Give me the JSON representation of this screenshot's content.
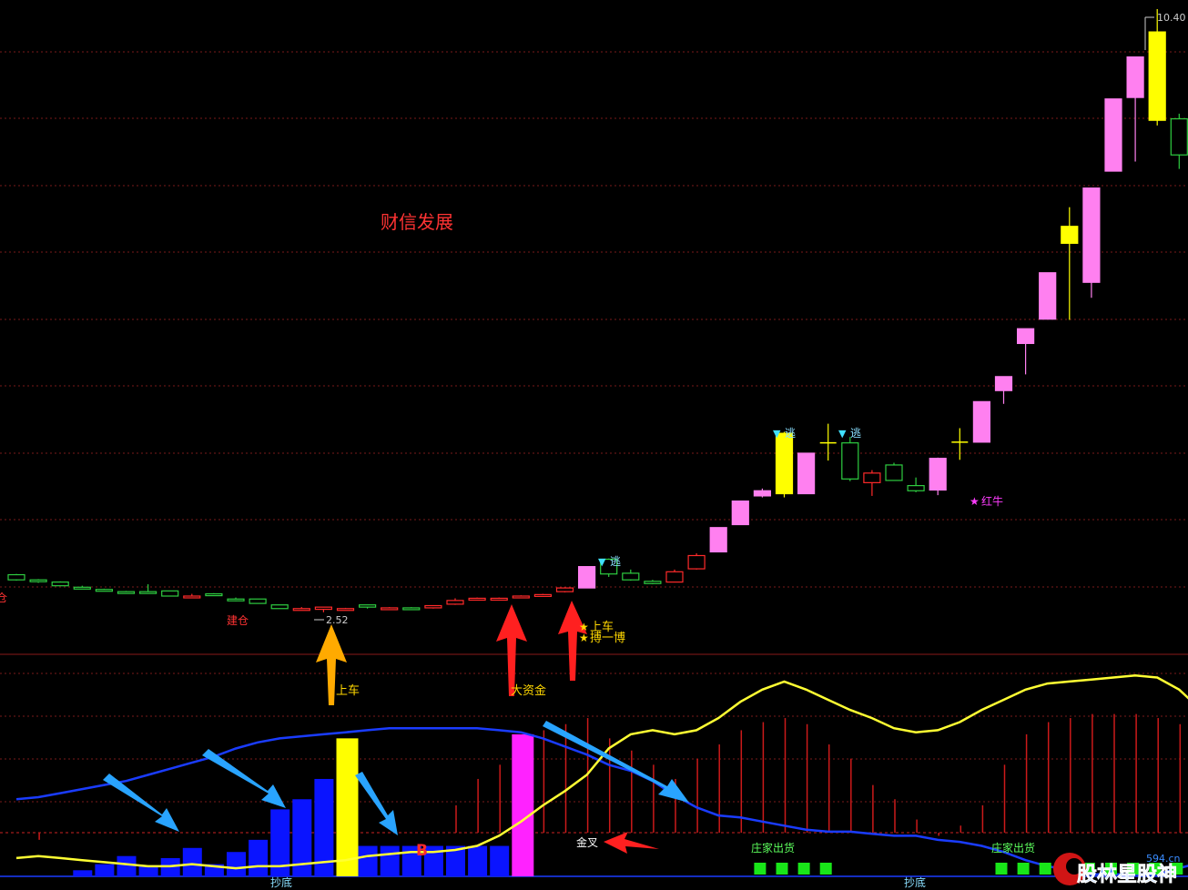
{
  "stock_name": "财信发展",
  "colors": {
    "bg": "#000000",
    "grid": "#7a1a1a",
    "up": "#ff2a2a",
    "down": "#2ecc40",
    "pink": "#ff80f0",
    "yellow": "#ffff00",
    "blue_bar": "#0a14ff",
    "magenta": "#ff22ff",
    "blue_line": "#1a3cff",
    "yellow_line": "#ffff33",
    "cyan": "#40e0ff",
    "vol_red": "#cc1a1a",
    "label_red": "#ff3333",
    "label_gold": "#ffd700",
    "label_white": "#ffffff",
    "label_green": "#5dff5d",
    "label_cyan": "#8adfff",
    "label_magenta": "#ff3dff"
  },
  "chart_data": {
    "type": "candlestick",
    "title": "财信发展",
    "price_high_label": "10.40",
    "price_low_label": "2.52",
    "ylim": [
      1.8,
      10.9
    ],
    "candles": [
      {
        "o": 2.96,
        "c": 3.03,
        "h": 3.04,
        "l": 2.95,
        "t": "down"
      },
      {
        "o": 2.94,
        "c": 2.96,
        "h": 2.97,
        "l": 2.92,
        "t": "down"
      },
      {
        "o": 2.88,
        "c": 2.93,
        "h": 2.94,
        "l": 2.88,
        "t": "down"
      },
      {
        "o": 2.86,
        "c": 2.86,
        "h": 2.88,
        "l": 2.84,
        "t": "down"
      },
      {
        "o": 2.81,
        "c": 2.83,
        "h": 2.84,
        "l": 2.81,
        "t": "down"
      },
      {
        "o": 2.8,
        "c": 2.8,
        "h": 2.81,
        "l": 2.79,
        "t": "down"
      },
      {
        "o": 2.8,
        "c": 2.8,
        "h": 2.9,
        "l": 2.79,
        "t": "down"
      },
      {
        "o": 2.74,
        "c": 2.81,
        "h": 2.81,
        "l": 2.74,
        "t": "down"
      },
      {
        "o": 2.74,
        "c": 2.74,
        "h": 2.77,
        "l": 2.73,
        "t": "up"
      },
      {
        "o": 2.75,
        "c": 2.77,
        "h": 2.78,
        "l": 2.75,
        "t": "down"
      },
      {
        "o": 2.7,
        "c": 2.7,
        "h": 2.72,
        "l": 2.67,
        "t": "down"
      },
      {
        "o": 2.64,
        "c": 2.7,
        "h": 2.7,
        "l": 2.64,
        "t": "down"
      },
      {
        "o": 2.57,
        "c": 2.62,
        "h": 2.62,
        "l": 2.57,
        "t": "down"
      },
      {
        "o": 2.57,
        "c": 2.57,
        "h": 2.59,
        "l": 2.56,
        "t": "up"
      },
      {
        "o": 2.56,
        "c": 2.59,
        "h": 2.59,
        "l": 2.52,
        "t": "up"
      },
      {
        "o": 2.57,
        "c": 2.57,
        "h": 2.58,
        "l": 2.55,
        "t": "up"
      },
      {
        "o": 2.59,
        "c": 2.62,
        "h": 2.62,
        "l": 2.57,
        "t": "down"
      },
      {
        "o": 2.57,
        "c": 2.58,
        "h": 2.59,
        "l": 2.57,
        "t": "up"
      },
      {
        "o": 2.58,
        "c": 2.58,
        "h": 2.59,
        "l": 2.57,
        "t": "down"
      },
      {
        "o": 2.58,
        "c": 2.61,
        "h": 2.61,
        "l": 2.57,
        "t": "up"
      },
      {
        "o": 2.63,
        "c": 2.68,
        "h": 2.71,
        "l": 2.62,
        "t": "up"
      },
      {
        "o": 2.7,
        "c": 2.71,
        "h": 2.72,
        "l": 2.69,
        "t": "up"
      },
      {
        "o": 2.71,
        "c": 2.71,
        "h": 2.72,
        "l": 2.7,
        "t": "up"
      },
      {
        "o": 2.73,
        "c": 2.74,
        "h": 2.75,
        "l": 2.71,
        "t": "up"
      },
      {
        "o": 2.76,
        "c": 2.75,
        "h": 2.77,
        "l": 2.74,
        "t": "up"
      },
      {
        "o": 2.8,
        "c": 2.85,
        "h": 2.86,
        "l": 2.79,
        "t": "up"
      },
      {
        "o": 2.85,
        "c": 3.14,
        "h": 3.14,
        "l": 2.85,
        "t": "pink"
      },
      {
        "o": 3.24,
        "c": 3.04,
        "h": 3.25,
        "l": 3.0,
        "t": "down"
      },
      {
        "o": 3.05,
        "c": 2.96,
        "h": 3.1,
        "l": 2.95,
        "t": "down"
      },
      {
        "o": 2.94,
        "c": 2.91,
        "h": 2.96,
        "l": 2.9,
        "t": "down"
      },
      {
        "o": 2.93,
        "c": 3.07,
        "h": 3.1,
        "l": 2.93,
        "t": "up"
      },
      {
        "o": 3.11,
        "c": 3.29,
        "h": 3.32,
        "l": 3.1,
        "t": "up"
      },
      {
        "o": 3.34,
        "c": 3.67,
        "h": 3.67,
        "l": 3.34,
        "t": "pink"
      },
      {
        "o": 3.71,
        "c": 4.03,
        "h": 4.03,
        "l": 3.71,
        "t": "pink"
      },
      {
        "o": 4.1,
        "c": 4.17,
        "h": 4.2,
        "l": 4.08,
        "t": "pink"
      },
      {
        "o": 4.13,
        "c": 4.95,
        "h": 4.97,
        "l": 4.08,
        "t": "yellow"
      },
      {
        "o": 4.13,
        "c": 4.68,
        "h": 4.68,
        "l": 4.13,
        "t": "pink"
      },
      {
        "o": 4.82,
        "c": 4.82,
        "h": 5.08,
        "l": 4.58,
        "t": "flat"
      },
      {
        "o": 4.82,
        "c": 4.33,
        "h": 4.9,
        "l": 4.3,
        "t": "down"
      },
      {
        "o": 4.28,
        "c": 4.41,
        "h": 4.45,
        "l": 4.1,
        "t": "up"
      },
      {
        "o": 4.31,
        "c": 4.52,
        "h": 4.55,
        "l": 4.31,
        "t": "down"
      },
      {
        "o": 4.17,
        "c": 4.24,
        "h": 4.35,
        "l": 4.15,
        "t": "down"
      },
      {
        "o": 4.18,
        "c": 4.61,
        "h": 4.62,
        "l": 4.11,
        "t": "pink"
      },
      {
        "o": 4.83,
        "c": 4.83,
        "h": 5.02,
        "l": 4.59,
        "t": "flat"
      },
      {
        "o": 4.83,
        "c": 5.38,
        "h": 5.38,
        "l": 4.83,
        "t": "pink"
      },
      {
        "o": 5.53,
        "c": 5.72,
        "h": 5.72,
        "l": 5.35,
        "t": "pink"
      },
      {
        "o": 6.17,
        "c": 6.37,
        "h": 6.37,
        "l": 5.75,
        "t": "pink"
      },
      {
        "o": 6.5,
        "c": 7.13,
        "h": 7.13,
        "l": 6.5,
        "t": "pink"
      },
      {
        "o": 7.53,
        "c": 7.76,
        "h": 8.02,
        "l": 6.49,
        "t": "yellow"
      },
      {
        "o": 7.0,
        "c": 8.28,
        "h": 8.28,
        "l": 6.79,
        "t": "pink"
      },
      {
        "o": 8.51,
        "c": 9.49,
        "h": 9.49,
        "l": 8.51,
        "t": "pink"
      },
      {
        "o": 9.51,
        "c": 10.06,
        "h": 10.06,
        "l": 8.64,
        "t": "pink"
      },
      {
        "o": 9.2,
        "c": 10.4,
        "h": 10.71,
        "l": 9.13,
        "t": "yellow"
      },
      {
        "o": 9.22,
        "c": 8.73,
        "h": 9.29,
        "l": 8.54,
        "t": "down"
      },
      {
        "o": 8.52,
        "c": 8.37,
        "h": 8.72,
        "l": 8.36,
        "t": "down"
      }
    ],
    "indicator": {
      "ylim": [
        0,
        100
      ],
      "bars": [
        {
          "i": 3,
          "v": 3,
          "c": "blue"
        },
        {
          "i": 4,
          "v": 6,
          "c": "blue"
        },
        {
          "i": 5,
          "v": 10,
          "c": "blue"
        },
        {
          "i": 6,
          "v": 5,
          "c": "blue"
        },
        {
          "i": 7,
          "v": 9,
          "c": "blue"
        },
        {
          "i": 8,
          "v": 14,
          "c": "blue"
        },
        {
          "i": 9,
          "v": 6,
          "c": "blue"
        },
        {
          "i": 10,
          "v": 12,
          "c": "blue"
        },
        {
          "i": 11,
          "v": 18,
          "c": "blue"
        },
        {
          "i": 12,
          "v": 33,
          "c": "blue"
        },
        {
          "i": 13,
          "v": 38,
          "c": "blue"
        },
        {
          "i": 14,
          "v": 48,
          "c": "blue"
        },
        {
          "i": 15,
          "v": 68,
          "c": "yellow"
        },
        {
          "i": 16,
          "v": 15,
          "c": "blue"
        },
        {
          "i": 17,
          "v": 15,
          "c": "blue"
        },
        {
          "i": 18,
          "v": 15,
          "c": "blue"
        },
        {
          "i": 19,
          "v": 15,
          "c": "blue"
        },
        {
          "i": 20,
          "v": 15,
          "c": "blue"
        },
        {
          "i": 21,
          "v": 15,
          "c": "blue"
        },
        {
          "i": 22,
          "v": 15,
          "c": "blue"
        },
        {
          "i": 23,
          "v": 70,
          "c": "magenta"
        }
      ],
      "thin_bars": [
        {
          "i": 1,
          "v": 18
        },
        {
          "i": 20,
          "v": 35
        },
        {
          "i": 21,
          "v": 48
        },
        {
          "i": 22,
          "v": 55
        },
        {
          "i": 24,
          "v": 72
        },
        {
          "i": 25,
          "v": 75
        },
        {
          "i": 26,
          "v": 78
        },
        {
          "i": 27,
          "v": 68
        },
        {
          "i": 28,
          "v": 62
        },
        {
          "i": 29,
          "v": 55
        },
        {
          "i": 30,
          "v": 48
        },
        {
          "i": 31,
          "v": 58
        },
        {
          "i": 32,
          "v": 65
        },
        {
          "i": 33,
          "v": 72
        },
        {
          "i": 34,
          "v": 76
        },
        {
          "i": 35,
          "v": 78
        },
        {
          "i": 36,
          "v": 75
        },
        {
          "i": 37,
          "v": 65
        },
        {
          "i": 38,
          "v": 58
        },
        {
          "i": 39,
          "v": 45
        },
        {
          "i": 40,
          "v": 38
        },
        {
          "i": 41,
          "v": 28
        },
        {
          "i": 42,
          "v": 20
        },
        {
          "i": 43,
          "v": 25
        },
        {
          "i": 44,
          "v": 35
        },
        {
          "i": 45,
          "v": 55
        },
        {
          "i": 46,
          "v": 70
        },
        {
          "i": 47,
          "v": 76
        },
        {
          "i": 48,
          "v": 78
        },
        {
          "i": 49,
          "v": 80
        },
        {
          "i": 50,
          "v": 80
        },
        {
          "i": 51,
          "v": 80
        },
        {
          "i": 52,
          "v": 78
        },
        {
          "i": 53,
          "v": 75
        },
        {
          "i": 54,
          "v": 66
        }
      ],
      "green_squares": [
        34,
        35,
        36,
        37,
        45,
        46,
        47,
        48,
        49,
        50,
        51,
        52,
        53
      ],
      "blue_line": [
        38,
        39,
        41,
        43,
        45,
        47,
        50,
        53,
        56,
        59,
        63,
        66,
        68,
        69,
        70,
        71,
        72,
        73,
        73,
        73,
        73,
        73,
        72,
        71,
        68,
        64,
        60,
        55,
        52,
        47,
        40,
        34,
        30,
        29,
        27,
        25,
        23,
        22,
        22,
        21,
        20,
        20,
        18,
        17,
        15,
        12,
        8,
        5,
        3,
        1,
        1,
        1,
        1,
        4,
        7
      ],
      "yellow_line": [
        9,
        10,
        9,
        8,
        7,
        6,
        5,
        5,
        6,
        5,
        4,
        5,
        5,
        6,
        7,
        8,
        10,
        11,
        12,
        12,
        13,
        15,
        20,
        27,
        35,
        42,
        50,
        63,
        70,
        72,
        70,
        72,
        78,
        86,
        92,
        96,
        92,
        87,
        82,
        78,
        73,
        71,
        72,
        76,
        82,
        87,
        92,
        95,
        96,
        97,
        98,
        99,
        98,
        92,
        82
      ]
    }
  },
  "annotations": {
    "jiancang": "建仓",
    "cang_left": "仓",
    "shangche_1": "上车",
    "dazijin": "大资金",
    "shangche_2": "上车",
    "boyibo": "搏一博",
    "tao_1": "逃",
    "tao_2": "逃",
    "tao_3": "逃",
    "hongniu": "红牛",
    "b_mark": "B",
    "jincha": "金叉",
    "zhuangjia_1": "庄家出货",
    "zhuangjia_2": "庄家出货",
    "chaodi_1": "抄底",
    "chaodi_2": "抄底",
    "star": "★",
    "triangle": "▼"
  },
  "watermark": {
    "brand": "股林星股神",
    "site": "594.cn"
  }
}
